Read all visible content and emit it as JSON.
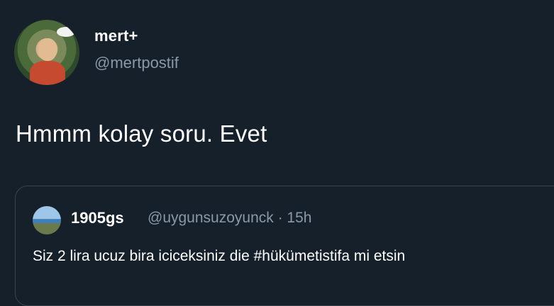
{
  "tweet": {
    "author": {
      "display_name": "mert+",
      "handle": "@mertpostif"
    },
    "text": "Hmmm kolay soru. Evet"
  },
  "quoted_tweet": {
    "author": {
      "display_name": "1905gs",
      "handle": "@uygunsuzoyunck"
    },
    "meta": "@uygunsuzoyunck · 15h",
    "text": "Siz 2 lira ucuz bira iciceksiniz die #hükümetistifa mi etsin"
  },
  "colors": {
    "background": "#15202b",
    "secondary_text": "#8b98a5",
    "border": "#38444d"
  }
}
